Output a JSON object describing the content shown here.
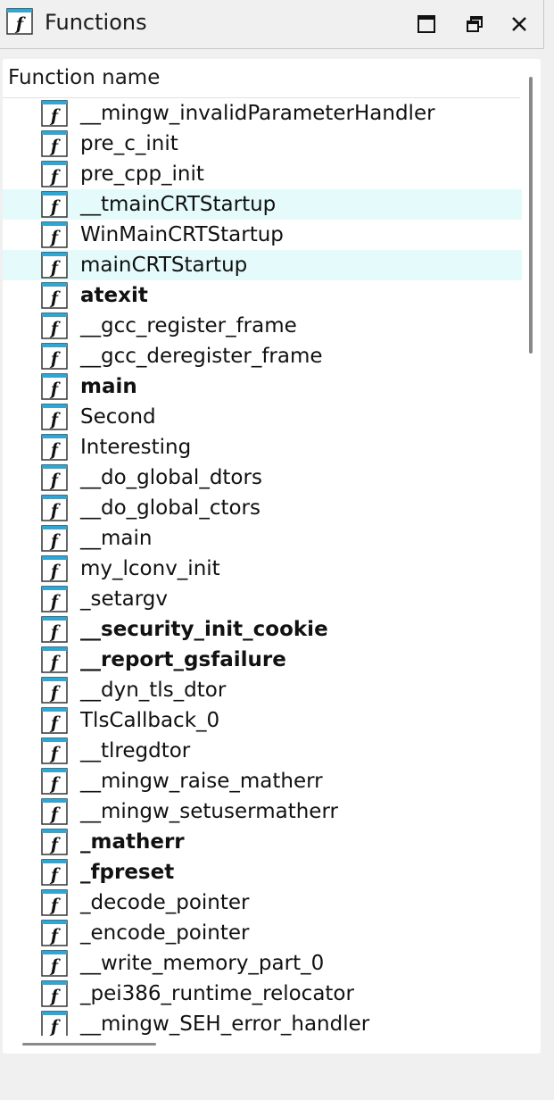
{
  "window": {
    "title": "Functions",
    "title_icon": "function-icon",
    "controls": [
      "maximize-icon",
      "restore-icon",
      "close-icon"
    ]
  },
  "table": {
    "column_header": "Function name",
    "rows": [
      {
        "name": "__mingw_invalidParameterHandler",
        "bold": false,
        "selected": false
      },
      {
        "name": "pre_c_init",
        "bold": false,
        "selected": false
      },
      {
        "name": "pre_cpp_init",
        "bold": false,
        "selected": false
      },
      {
        "name": "__tmainCRTStartup",
        "bold": false,
        "selected": true
      },
      {
        "name": "WinMainCRTStartup",
        "bold": false,
        "selected": false
      },
      {
        "name": "mainCRTStartup",
        "bold": false,
        "selected": true
      },
      {
        "name": "atexit",
        "bold": true,
        "selected": false
      },
      {
        "name": "__gcc_register_frame",
        "bold": false,
        "selected": false
      },
      {
        "name": "__gcc_deregister_frame",
        "bold": false,
        "selected": false
      },
      {
        "name": "main",
        "bold": true,
        "selected": false
      },
      {
        "name": "Second",
        "bold": false,
        "selected": false
      },
      {
        "name": "Interesting",
        "bold": false,
        "selected": false
      },
      {
        "name": "__do_global_dtors",
        "bold": false,
        "selected": false
      },
      {
        "name": "__do_global_ctors",
        "bold": false,
        "selected": false
      },
      {
        "name": "__main",
        "bold": false,
        "selected": false
      },
      {
        "name": "my_lconv_init",
        "bold": false,
        "selected": false
      },
      {
        "name": "_setargv",
        "bold": false,
        "selected": false
      },
      {
        "name": "__security_init_cookie",
        "bold": true,
        "selected": false
      },
      {
        "name": "__report_gsfailure",
        "bold": true,
        "selected": false
      },
      {
        "name": "__dyn_tls_dtor",
        "bold": false,
        "selected": false
      },
      {
        "name": "TlsCallback_0",
        "bold": false,
        "selected": false
      },
      {
        "name": "__tlregdtor",
        "bold": false,
        "selected": false
      },
      {
        "name": "__mingw_raise_matherr",
        "bold": false,
        "selected": false
      },
      {
        "name": "__mingw_setusermatherr",
        "bold": false,
        "selected": false
      },
      {
        "name": "_matherr",
        "bold": true,
        "selected": false
      },
      {
        "name": "_fpreset",
        "bold": true,
        "selected": false
      },
      {
        "name": "_decode_pointer",
        "bold": false,
        "selected": false
      },
      {
        "name": "_encode_pointer",
        "bold": false,
        "selected": false
      },
      {
        "name": "__write_memory_part_0",
        "bold": false,
        "selected": false
      },
      {
        "name": "_pei386_runtime_relocator",
        "bold": false,
        "selected": false
      },
      {
        "name": "__mingw_SEH_error_handler",
        "bold": false,
        "selected": false
      }
    ]
  },
  "colors": {
    "selected_row": "#e5fbfb",
    "icon_band": "#2aa8d8"
  }
}
